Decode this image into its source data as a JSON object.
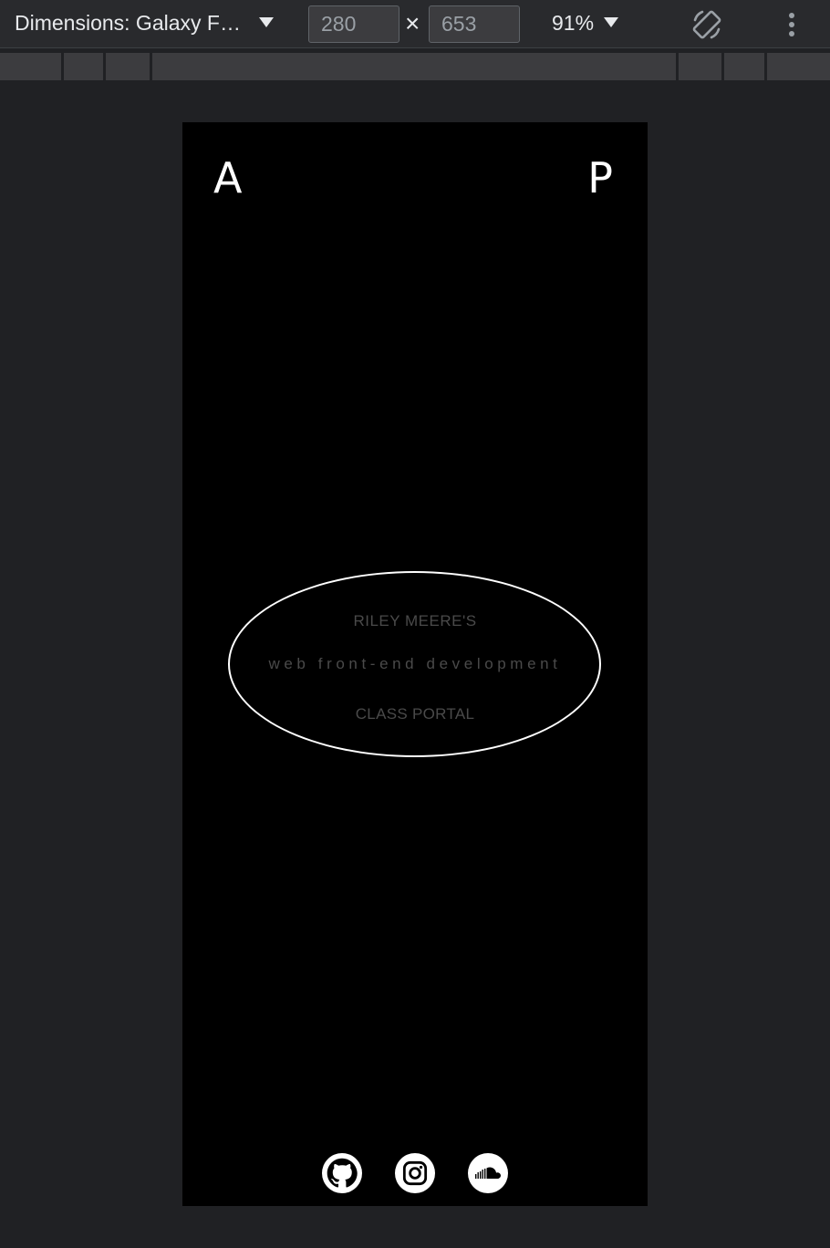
{
  "devtools_toolbar": {
    "dimensions_label": "Dimensions: Galaxy F…",
    "width_value": "280",
    "height_value": "653",
    "times_symbol": "×",
    "zoom_label": "91%"
  },
  "page": {
    "left_letter": "A",
    "right_letter": "P",
    "title_line1": "RILEY MEERE'S",
    "title_line2": "web front-end development",
    "title_line3": "CLASS PORTAL",
    "social_icons": [
      "github-icon",
      "instagram-icon",
      "soundcloud-icon"
    ]
  },
  "colors": {
    "page_background": "#000000",
    "devtools_background": "#202124",
    "ellipse_stroke": "#ffffff",
    "muted_text": "#4a4a4a"
  }
}
